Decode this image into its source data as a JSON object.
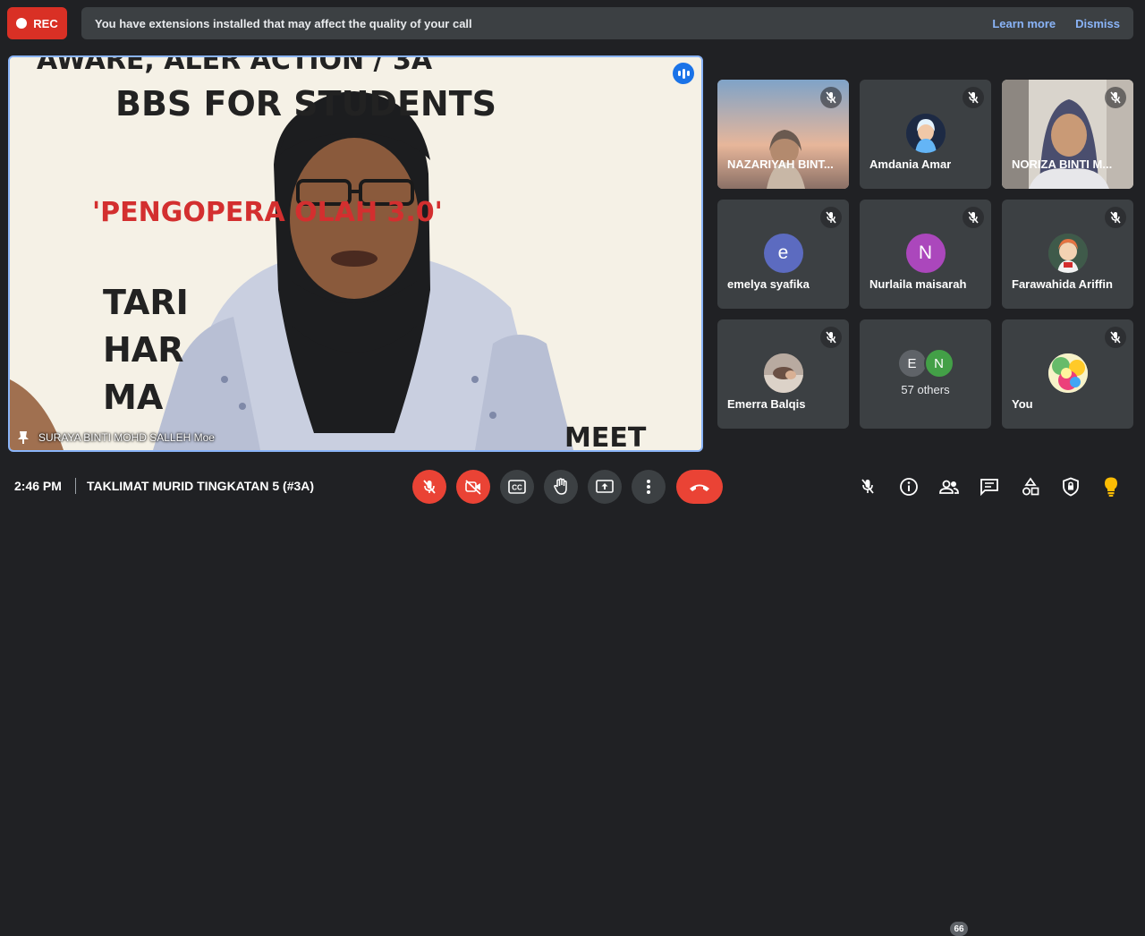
{
  "recording": {
    "label": "REC",
    "color": "#d93025"
  },
  "banner": {
    "message": "You have extensions installed that may affect the quality of your call",
    "learn_more": "Learn more",
    "dismiss": "Dismiss"
  },
  "main_video": {
    "participant": "SURAYA BINTI MOHD SALLEH Moe",
    "speaking": true,
    "slide_lines": [
      "AWARE, ALER ACTION / 3A",
      "BBS FOR STUDENTS",
      "'PENGOPERA OLAH 3.0'",
      "TARI",
      "HAR",
      "MA",
      "MEET"
    ]
  },
  "participants": [
    {
      "name": "NAZARIYAH BINT...",
      "muted": true,
      "avatar": "photo-icon"
    },
    {
      "name": "Amdania Amar",
      "muted": true,
      "avatar": "photo-icon"
    },
    {
      "name": "NORIZA BINTI M...",
      "muted": true,
      "avatar": "photo-icon"
    },
    {
      "name": "emelya syafika",
      "muted": true,
      "initial": "e",
      "color": "#5c6bc0"
    },
    {
      "name": "Nurlaila maisarah",
      "muted": true,
      "initial": "N",
      "color": "#ab47bc"
    },
    {
      "name": "Farawahida Ariffin",
      "muted": true,
      "avatar": "photo-icon"
    },
    {
      "name": "Emerra Balqis",
      "muted": true,
      "avatar": "photo-icon"
    },
    {
      "name": "57 others",
      "initials": [
        "E",
        "N"
      ],
      "colors": [
        "#5f6368",
        "#43a047"
      ]
    },
    {
      "name": "You",
      "muted": true,
      "avatar": "photo-icon"
    }
  ],
  "bottom_bar": {
    "time": "2:46 PM",
    "meeting_name": "TAKLIMAT MURID TINGKATAN 5 (#3A)",
    "people_count": "66",
    "controls": [
      "mic-off-icon",
      "camera-off-icon",
      "captions-icon",
      "raise-hand-icon",
      "present-icon",
      "more-options-icon",
      "end-call-icon"
    ],
    "right_icons": [
      "mic-off-icon",
      "info-icon",
      "people-icon",
      "chat-icon",
      "activities-icon",
      "host-controls-icon",
      "bulb-icon"
    ]
  }
}
